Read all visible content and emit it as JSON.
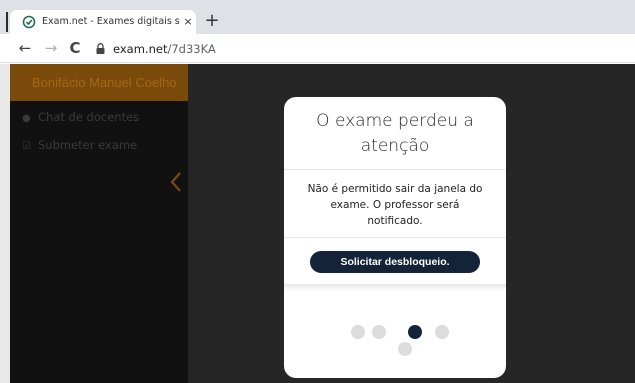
{
  "browser": {
    "tab_title": "Exam.net - Exames digitais seguros",
    "tab_close": "×",
    "new_tab": "+",
    "nav_back": "←",
    "nav_forward": "→",
    "nav_reload": "C",
    "url_domain": "exam.net",
    "url_path": "/7d33KA"
  },
  "sidebar": {
    "student_name": "Bonifácio Manuel Coelho",
    "items": [
      {
        "icon": "chat-icon",
        "label": "Chat de docentes"
      },
      {
        "icon": "checkbox-icon",
        "label": "Submeter exame"
      }
    ],
    "accent_color": "#a66514"
  },
  "modal": {
    "title": "O exame perdeu a atenção",
    "message": "Não é permitido sair da janela do exame. O professor será notificado.",
    "button_label": "Solicitar desbloqueio.",
    "button_color": "#152338"
  }
}
